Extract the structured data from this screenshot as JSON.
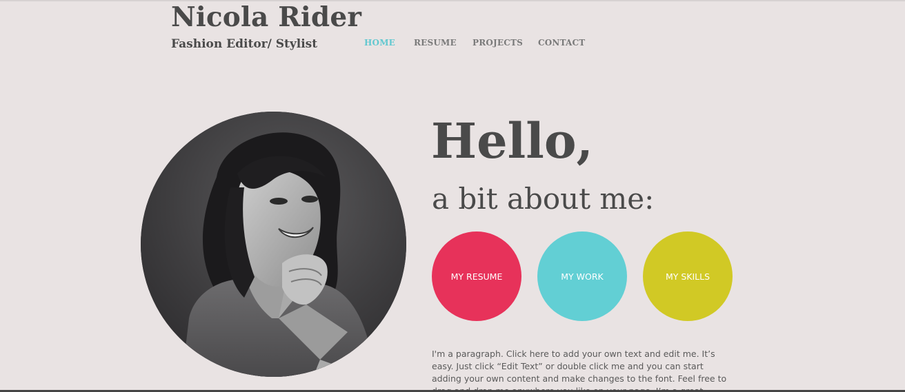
{
  "header": {
    "site_name": "Nicola Rider",
    "tagline": "Fashion Editor/ Stylist"
  },
  "nav": {
    "items": [
      {
        "label": "HOME",
        "active": true
      },
      {
        "label": "RESUME",
        "active": false
      },
      {
        "label": "PROJECTS",
        "active": false
      },
      {
        "label": "CONTACT",
        "active": false
      }
    ]
  },
  "hero": {
    "heading": "Hello,",
    "subheading": "a bit about me:"
  },
  "buttons": [
    {
      "label": "MY RESUME",
      "color": "#e7325a"
    },
    {
      "label": "MY WORK",
      "color": "#62cfd4"
    },
    {
      "label": "MY SKILLS",
      "color": "#d1c925"
    }
  ],
  "about": {
    "paragraph": "I'm a paragraph. Click here to add your own text and edit me. It’s easy. Just click “Edit Text” or double click me and you can start adding your own content and make changes to the font. Feel free to drag and drop me anywhere you like on your page. I’m a great place for you to write."
  },
  "colors": {
    "background": "#e9e3e3",
    "nav_active": "#62c8d0",
    "text": "#4a4a4a"
  }
}
